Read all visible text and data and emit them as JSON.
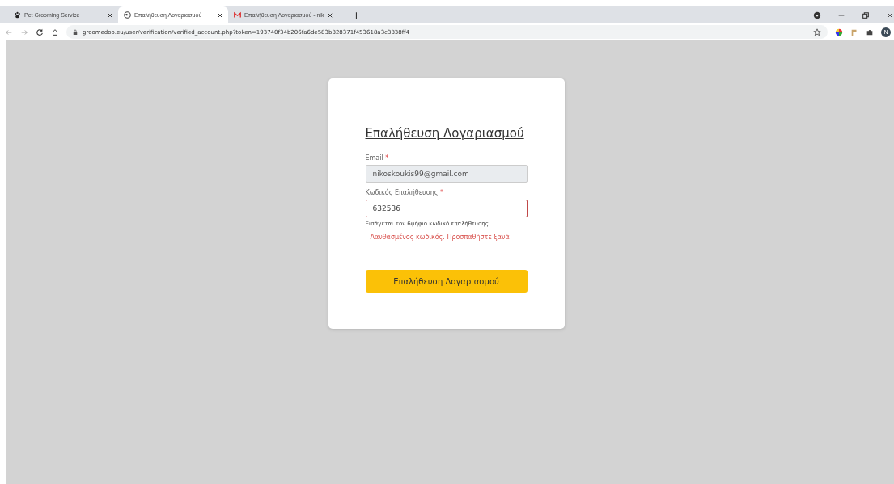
{
  "browser": {
    "tabs": [
      {
        "title": "Pet Grooming Service",
        "selected": false
      },
      {
        "title": "Επαλήθευση Λογαριασμού",
        "selected": true
      },
      {
        "title": "Επαλήθευση Λογαριασμού - nik",
        "selected": false
      }
    ],
    "new_tab": "+",
    "address": "groomedoo.eu/user/verification/verified_account.php?token=193740f34b206fa6de583b828371f453618a3c3838ff4",
    "profile_initial": "N"
  },
  "form": {
    "title": "Επαλήθευση Λογαριασμού",
    "fields": [
      {
        "label": "Email",
        "required_mark": "*",
        "value": "nikoskoukis99@gmail.com",
        "disabled": true,
        "invalid": false
      },
      {
        "label": "Κωδικός Επαλήθευσης",
        "required_mark": "*",
        "value": "632536",
        "disabled": false,
        "invalid": true,
        "hint": "Εισάγεται τον 6ψήφιο κωδικό επαλήθευσης",
        "error": "Λανθασμένος κωδικός. Προσπαθήστε ξανά"
      }
    ],
    "submit": "Επαλήθευση Λογαριασμού"
  }
}
